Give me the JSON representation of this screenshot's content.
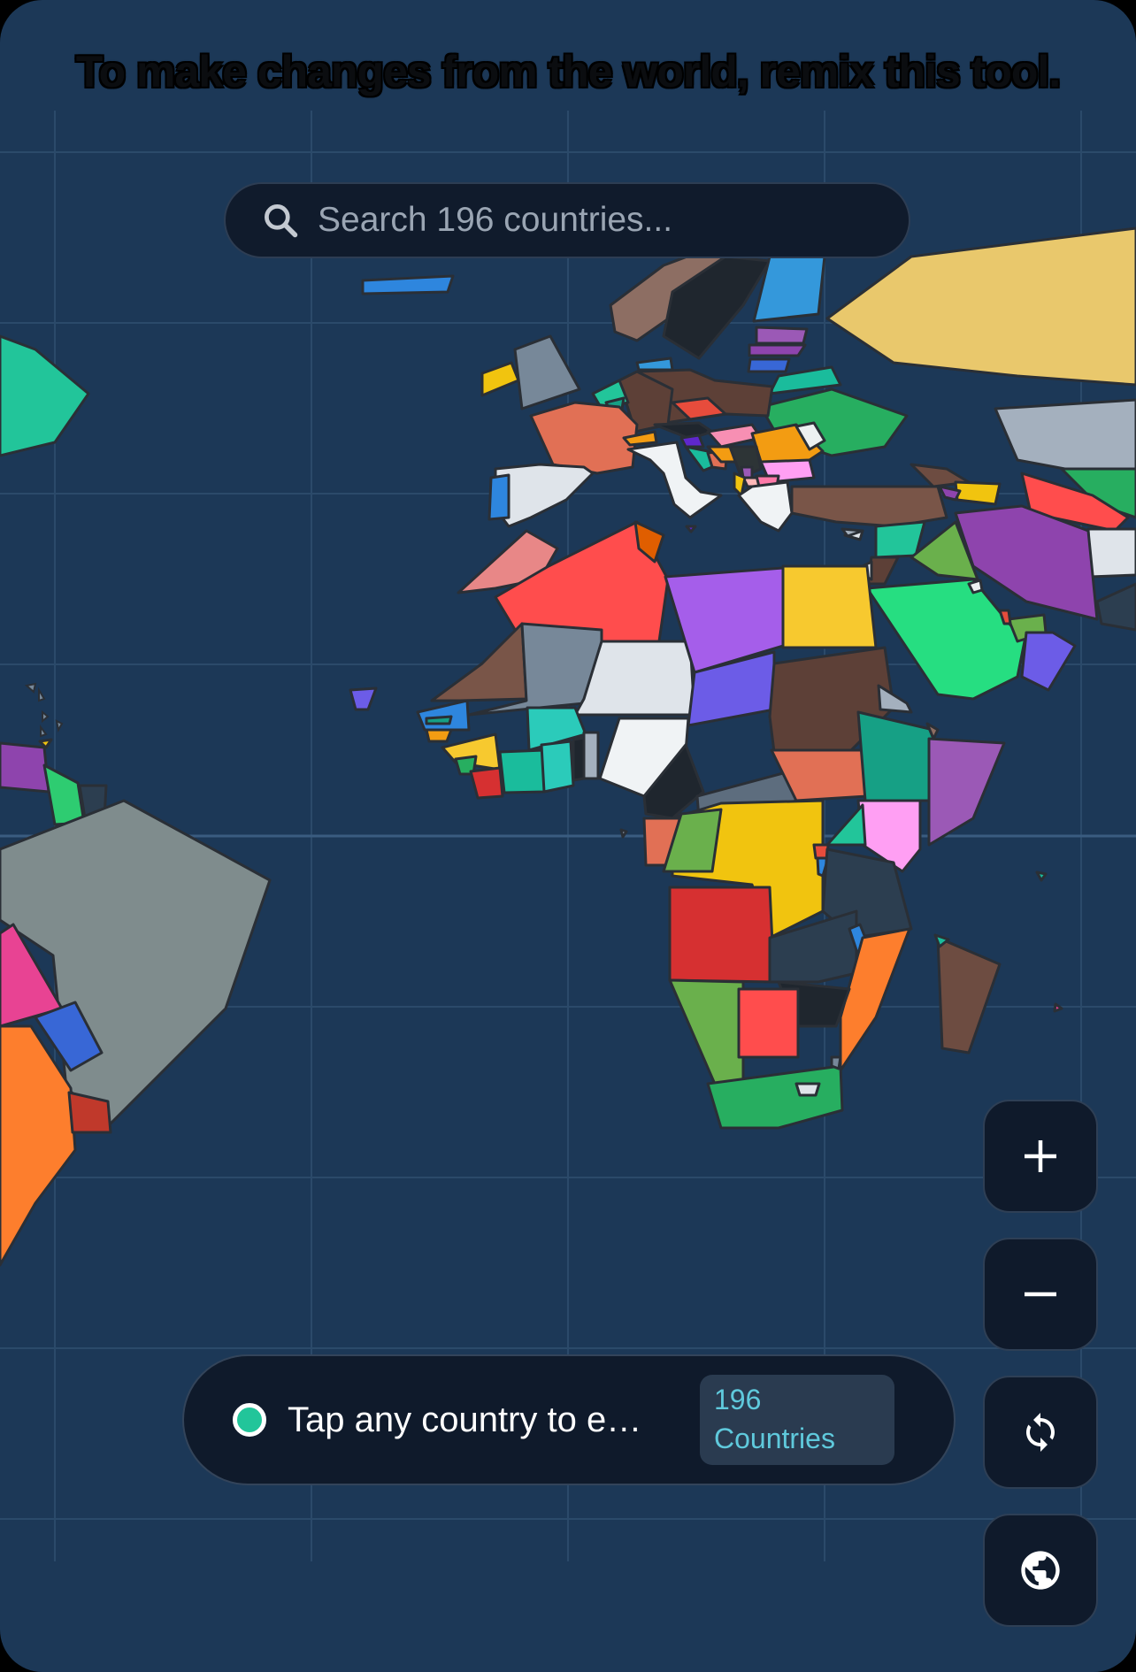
{
  "banner": {
    "text": "To make changes from the world, remix this tool."
  },
  "search": {
    "placeholder": "Search 196 countries...",
    "icon": "search-icon"
  },
  "controls": [
    {
      "name": "zoom-in-button",
      "icon": "plus-icon"
    },
    {
      "name": "zoom-out-button",
      "icon": "minus-icon"
    },
    {
      "name": "refresh-button",
      "icon": "refresh-icon"
    },
    {
      "name": "globe-button",
      "icon": "globe-icon"
    }
  ],
  "info_bar": {
    "message": "Tap any country to explore",
    "count_number": "196",
    "count_label": "Countries"
  },
  "colors": {
    "ocean": "#1c3857",
    "panel": "#0f1a2b",
    "accent": "#22c59a",
    "count_text": "#5fc9dc"
  }
}
